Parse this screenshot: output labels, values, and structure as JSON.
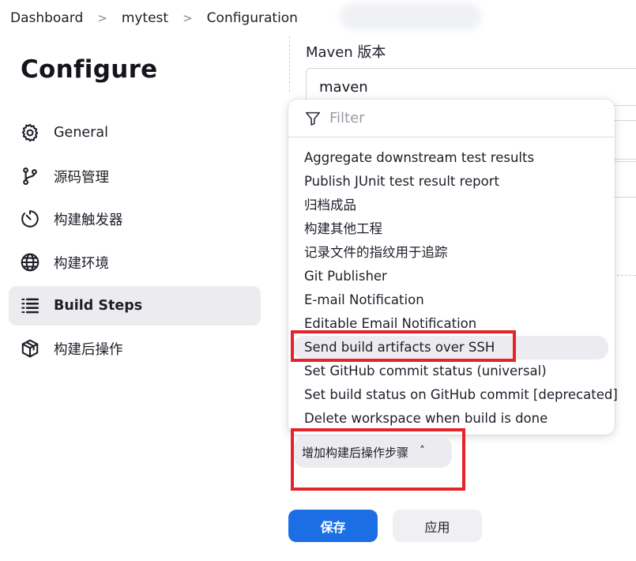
{
  "breadcrumb": {
    "items": [
      "Dashboard",
      "mytest",
      "Configuration"
    ],
    "separator": ">"
  },
  "sidebar": {
    "title": "Configure",
    "items": [
      {
        "label": "General",
        "icon": "gear-icon"
      },
      {
        "label": "源码管理",
        "icon": "branch-icon"
      },
      {
        "label": "构建触发器",
        "icon": "timer-icon"
      },
      {
        "label": "构建环境",
        "icon": "globe-icon"
      },
      {
        "label": "Build Steps",
        "icon": "list-steps-icon",
        "active": true
      },
      {
        "label": "构建后操作",
        "icon": "package-icon"
      }
    ]
  },
  "main": {
    "maven_label": "Maven 版本",
    "maven_value": "maven"
  },
  "dropdown": {
    "filter_placeholder": "Filter",
    "items": [
      "Aggregate downstream test results",
      "Publish JUnit test result report",
      "归档成品",
      "构建其他工程",
      "记录文件的指纹用于追踪",
      "Git Publisher",
      "E-mail Notification",
      "Editable Email Notification",
      "Send build artifacts over SSH",
      "Set GitHub commit status (universal)",
      "Set build status on GitHub commit [deprecated]",
      "Delete workspace when build is done"
    ],
    "hovered_index": 8
  },
  "add_step": {
    "label": "增加构建后操作步骤",
    "icon": "chevron-up-icon"
  },
  "actions": {
    "save": "保存",
    "apply": "应用"
  },
  "colors": {
    "primary": "#1b6ee3",
    "annotation": "#e5232a",
    "active_bg": "#ececf0"
  }
}
